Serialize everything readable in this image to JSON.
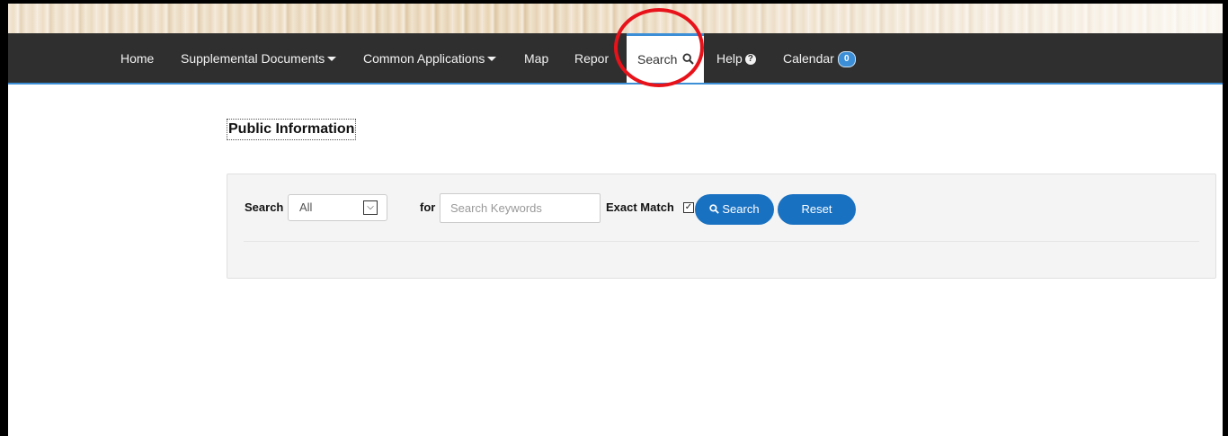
{
  "navbar": {
    "items": [
      {
        "label": "Home"
      },
      {
        "label": "Supplemental Documents"
      },
      {
        "label": "Common Applications"
      },
      {
        "label": "Map"
      },
      {
        "label": "Repor"
      },
      {
        "label": "Search"
      },
      {
        "label": "Help"
      },
      {
        "label": "Calendar"
      }
    ],
    "calendar_badge": "0",
    "active_item": "Search",
    "accent_color": "#3c8fd6"
  },
  "page": {
    "title": "Public Information"
  },
  "search_form": {
    "search_label": "Search",
    "category_select": {
      "selected": "All"
    },
    "for_label": "for",
    "keyword_input": {
      "value": "",
      "placeholder": "Search Keywords"
    },
    "exact_match_label": "Exact Match",
    "exact_match_checked": true,
    "search_button_label": "Search",
    "reset_button_label": "Reset"
  },
  "colors": {
    "button_blue": "#1971c2",
    "annotation_red": "#e8121a"
  },
  "icons": [
    "search-icon",
    "caret-down-icon",
    "question-circle-icon",
    "select-arrow-icon",
    "checkmark-icon"
  ]
}
